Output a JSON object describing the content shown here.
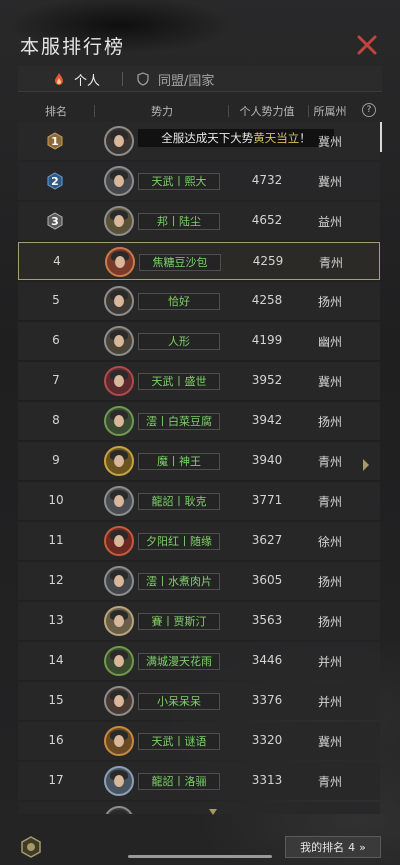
{
  "header": {
    "title": "本服排行榜"
  },
  "tabs": [
    {
      "label": "个人",
      "active": true
    },
    {
      "label": "同盟/国家",
      "active": false
    }
  ],
  "columns": {
    "rank": "排名",
    "faction": "势力",
    "power": "个人势力值",
    "region": "所属州",
    "help": "?"
  },
  "announcement": {
    "prefix": "全服达成天下大势",
    "highlight": "黄天当立",
    "suffix": "！"
  },
  "rows": [
    {
      "rank": "1",
      "faction": "",
      "power": "",
      "region": "冀州",
      "medal": "gold"
    },
    {
      "rank": "2",
      "faction": "天武丨熙大",
      "power": "4732",
      "region": "冀州",
      "medal": "blue"
    },
    {
      "rank": "3",
      "faction": "邦丨陆尘",
      "power": "4652",
      "region": "益州",
      "medal": "silver"
    },
    {
      "rank": "4",
      "faction": "焦糖豆沙包",
      "power": "4259",
      "region": "青州",
      "highlight": true
    },
    {
      "rank": "5",
      "faction": "恰好",
      "power": "4258",
      "region": "扬州"
    },
    {
      "rank": "6",
      "faction": "人形",
      "power": "4199",
      "region": "幽州"
    },
    {
      "rank": "7",
      "faction": "天武丨盛世",
      "power": "3952",
      "region": "冀州"
    },
    {
      "rank": "8",
      "faction": "澐丨白菜豆腐",
      "power": "3942",
      "region": "扬州"
    },
    {
      "rank": "9",
      "faction": "魔丨神王",
      "power": "3940",
      "region": "青州"
    },
    {
      "rank": "10",
      "faction": "龍詔丨耿克",
      "power": "3771",
      "region": "青州"
    },
    {
      "rank": "11",
      "faction": "夕阳红丨随缘",
      "power": "3627",
      "region": "徐州"
    },
    {
      "rank": "12",
      "faction": "澐丨水煮肉片",
      "power": "3605",
      "region": "扬州"
    },
    {
      "rank": "13",
      "faction": "賽丨贾斯汀",
      "power": "3563",
      "region": "扬州"
    },
    {
      "rank": "14",
      "faction": "满城漫天花雨",
      "power": "3446",
      "region": "并州"
    },
    {
      "rank": "15",
      "faction": "小呆呆呆",
      "power": "3376",
      "region": "并州"
    },
    {
      "rank": "16",
      "faction": "天武丨谜语",
      "power": "3320",
      "region": "冀州"
    },
    {
      "rank": "17",
      "faction": "龍詔丨洛骊",
      "power": "3313",
      "region": "青州"
    }
  ],
  "footer": {
    "my_rank_label": "我的排名",
    "my_rank_value": "4",
    "arrow": "»"
  },
  "colors": {
    "faction_text": "#7ed06a",
    "highlight_border": "#a59e78",
    "close_red": "#c0453c",
    "banner_highlight": "#d9c25c"
  }
}
